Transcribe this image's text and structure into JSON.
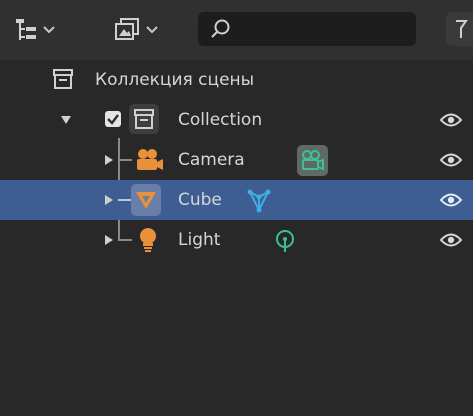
{
  "header": {
    "display_mode_icon": "outliner-display-icon",
    "filter_icon": "scene-filter-icon",
    "search": {
      "value": "",
      "placeholder": ""
    }
  },
  "tree": {
    "scene_collection": {
      "label": "Коллекция сцены",
      "icon": "collection-icon"
    },
    "collection": {
      "label": "Collection",
      "checked": true,
      "expanded": true,
      "icon": "collection-icon",
      "visible": true
    },
    "objects": [
      {
        "label": "Camera",
        "icon": "camera-icon",
        "data_icon": "camera-data-icon",
        "visible": true,
        "selected": false
      },
      {
        "label": "Cube",
        "icon": "mesh-object-icon",
        "data_icon": "mesh-data-icon",
        "visible": true,
        "selected": true
      },
      {
        "label": "Light",
        "icon": "light-icon",
        "data_icon": "light-data-icon",
        "visible": true,
        "selected": false
      }
    ]
  },
  "colors": {
    "background": "#282828",
    "header": "#303030",
    "selection": "#3d5d93",
    "object_orange": "#e8903a",
    "data_green": "#3cc09a",
    "mesh_cyan": "#3cb0e0",
    "text": "#d6d6d6"
  }
}
